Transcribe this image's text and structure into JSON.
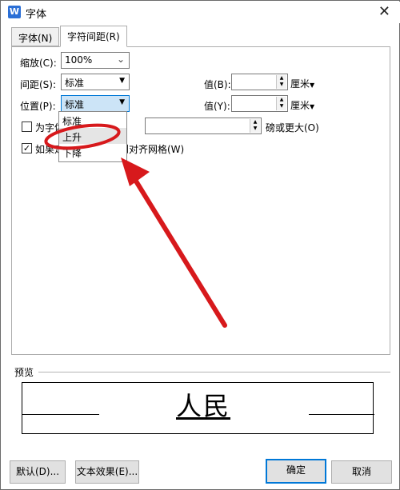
{
  "window": {
    "title": "字体",
    "icon_letter": "W"
  },
  "tabs": [
    {
      "label": "字体(N)"
    },
    {
      "label": "字符间距(R)"
    }
  ],
  "spacing": {
    "scale_label": "缩放(C):",
    "scale_value": "100%",
    "spacing_label": "间距(S):",
    "spacing_value": "标准",
    "position_label": "位置(P):",
    "position_value": "标准",
    "value_b_label": "值(B):",
    "value_y_label": "值(Y):",
    "unit": "厘米",
    "kerning_label": "为字体",
    "kerning_suffix": "磅或更大(O)",
    "grid_label_start": "如果定",
    "grid_label_end": "则对齐网格(W)"
  },
  "position_dropdown": {
    "options": [
      "标准",
      "上升",
      "下降"
    ],
    "highlighted": "上升"
  },
  "preview": {
    "label": "预览",
    "sample": "人民"
  },
  "buttons": {
    "default": "默认(D)...",
    "text_effect": "文本效果(E)...",
    "ok": "确定",
    "cancel": "取消"
  },
  "colors": {
    "annotation": "#d7191c",
    "accent": "#0078d7"
  }
}
